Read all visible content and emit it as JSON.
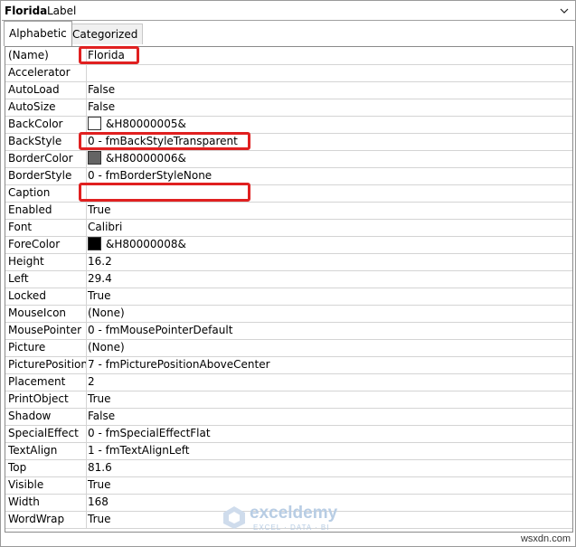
{
  "header": {
    "object_name": "Florida",
    "object_type": "Label"
  },
  "tabs": [
    {
      "label": "Alphabetic",
      "active": true
    },
    {
      "label": "Categorized",
      "active": false
    }
  ],
  "properties": [
    {
      "name": "(Name)",
      "value": "Florida"
    },
    {
      "name": "Accelerator",
      "value": ""
    },
    {
      "name": "AutoLoad",
      "value": "False"
    },
    {
      "name": "AutoSize",
      "value": "False"
    },
    {
      "name": "BackColor",
      "value": "&H80000005&",
      "swatch": "#ffffff"
    },
    {
      "name": "BackStyle",
      "value": "0 - fmBackStyleTransparent"
    },
    {
      "name": "BorderColor",
      "value": "&H80000006&",
      "swatch": "#646464"
    },
    {
      "name": "BorderStyle",
      "value": "0 - fmBorderStyleNone"
    },
    {
      "name": "Caption",
      "value": ""
    },
    {
      "name": "Enabled",
      "value": "True"
    },
    {
      "name": "Font",
      "value": "Calibri"
    },
    {
      "name": "ForeColor",
      "value": "&H80000008&",
      "swatch": "#000000"
    },
    {
      "name": "Height",
      "value": "16.2"
    },
    {
      "name": "Left",
      "value": "29.4"
    },
    {
      "name": "Locked",
      "value": "True"
    },
    {
      "name": "MouseIcon",
      "value": "(None)"
    },
    {
      "name": "MousePointer",
      "value": "0 - fmMousePointerDefault"
    },
    {
      "name": "Picture",
      "value": "(None)"
    },
    {
      "name": "PicturePosition",
      "value": "7 - fmPicturePositionAboveCenter"
    },
    {
      "name": "Placement",
      "value": "2"
    },
    {
      "name": "PrintObject",
      "value": "True"
    },
    {
      "name": "Shadow",
      "value": "False"
    },
    {
      "name": "SpecialEffect",
      "value": "0 - fmSpecialEffectFlat"
    },
    {
      "name": "TextAlign",
      "value": "1 - fmTextAlignLeft"
    },
    {
      "name": "Top",
      "value": "81.6"
    },
    {
      "name": "Visible",
      "value": "True"
    },
    {
      "name": "Width",
      "value": "168"
    },
    {
      "name": "WordWrap",
      "value": "True"
    }
  ],
  "highlight_color": "#e02020",
  "watermark": {
    "name": "exceldemy",
    "tagline": "EXCEL · DATA · BI"
  },
  "credit": "wsxdn.com"
}
